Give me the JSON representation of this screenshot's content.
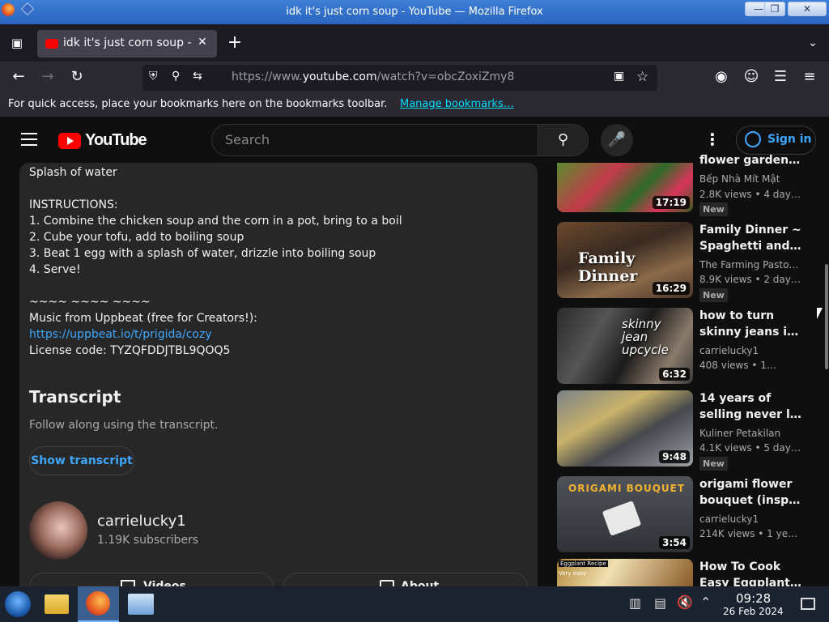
{
  "window": {
    "title": "idk it's just corn soup - YouTube — Mozilla Firefox"
  },
  "browser": {
    "tab_title": "idk it's just corn soup - YouTube",
    "url_prefix": "https://www.",
    "url_domain": "youtube.com",
    "url_path": "/watch?v=obcZoxiZmy8",
    "bookmarks_text": "For quick access, place your bookmarks here on the bookmarks toolbar.",
    "bookmarks_link": "Manage bookmarks…"
  },
  "youtube": {
    "logo_text": "YouTube",
    "search_placeholder": "Search",
    "sign_in": "Sign in"
  },
  "description": {
    "lines": [
      "Splash of water",
      "INSTRUCTIONS:",
      "1. Combine the chicken soup and the corn in a pot, bring to a boil",
      "2. Cube your tofu, add to boiling soup",
      "3. Beat 1 egg with a splash of water, drizzle into boiling soup",
      "4. Serve!",
      "~~~~ ~~~~ ~~~~",
      "Music from Uppbeat (free for Creators!):",
      "https://uppbeat.io/t/prigida/cozy",
      "License code: TYZQFDDJTBL9QOQ5"
    ],
    "transcript_heading": "Transcript",
    "transcript_sub": "Follow along using the transcript.",
    "show_transcript": "Show transcript",
    "channel_name": "carrielucky1",
    "subscribers": "1.19K subscribers",
    "videos_btn": "Videos",
    "about_btn": "About"
  },
  "sidebar": [
    {
      "title": "flower gardens,…",
      "channel": "Bếp Nhà Mít Mật",
      "meta": "2.8K views • 4 day…",
      "duration": "17:19",
      "badge": "New",
      "title2": ""
    },
    {
      "title": "Family Dinner ~",
      "title2": "Spaghetti and…",
      "channel": "The Farming Pasto…",
      "meta": "8.9K views • 2 day…",
      "duration": "16:29",
      "badge": "New"
    },
    {
      "title": "how to turn",
      "title2": "skinny jeans int…",
      "channel": "carrielucky1",
      "meta": "408 views • 1…",
      "duration": "6:32",
      "badge": ""
    },
    {
      "title": "14 years of",
      "title2": "selling never lac…",
      "channel": "Kuliner Petakilan",
      "meta": "4.1K views • 5 day…",
      "duration": "9:48",
      "badge": "New"
    },
    {
      "title": "origami flower",
      "title2": "bouquet (inspir…",
      "channel": "carrielucky1",
      "meta": "214K views • 1 ye…",
      "duration": "3:54",
      "badge": ""
    },
    {
      "title": "How To Cook",
      "title2": "Easy Eggplant…",
      "channel": "",
      "meta": "",
      "duration": "",
      "badge": ""
    }
  ],
  "thumb_text": {
    "family_dinner": "Family Dinner",
    "skinny_jeans": "skinny jean upcycle",
    "origami": "ORIGAMI BOUQUET",
    "eggplant": "Eggplant Recipe",
    "eggplant2": "Very easy"
  },
  "taskbar": {
    "time": "09:28",
    "date": "26 Feb 2024"
  }
}
